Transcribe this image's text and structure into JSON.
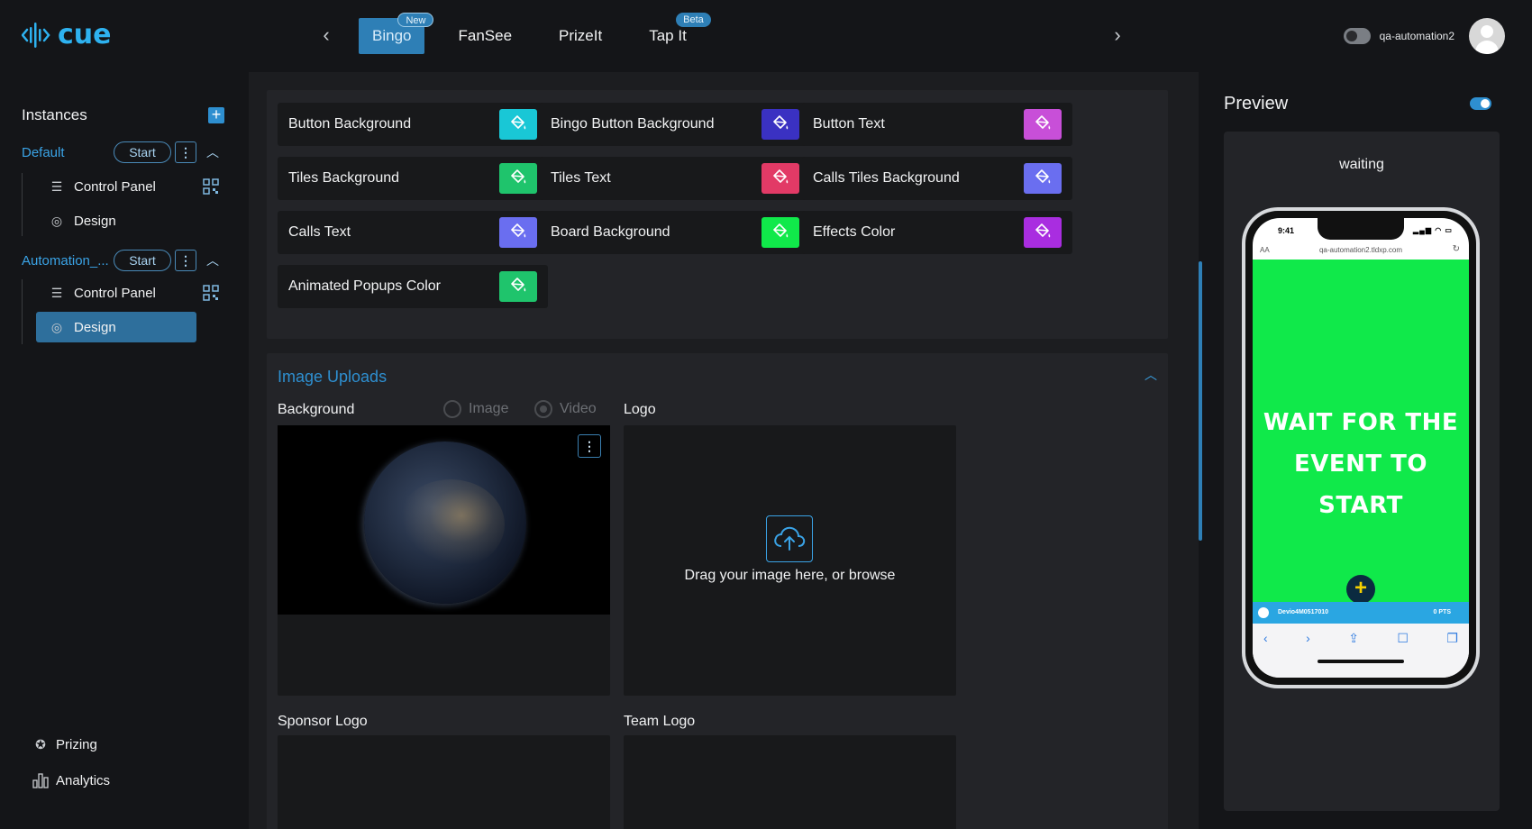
{
  "header": {
    "logo_text": "cue",
    "tabs": [
      {
        "label": "Bingo",
        "badge": "New",
        "active": true
      },
      {
        "label": "FanSee",
        "badge": "",
        "active": false
      },
      {
        "label": "PrizeIt",
        "badge": "",
        "active": false
      },
      {
        "label": "Tap It",
        "badge": "Beta",
        "active": false
      }
    ],
    "username": "qa-automation2",
    "prev_icon": "chevron-left-icon",
    "next_icon": "chevron-right-icon"
  },
  "sidebar": {
    "heading": "Instances",
    "add_icon": "plus-icon",
    "instances": [
      {
        "name": "Default",
        "start_label": "Start",
        "items": [
          {
            "label": "Control Panel",
            "icon": "sliders-icon"
          },
          {
            "label": "Design",
            "icon": "palette-icon"
          }
        ]
      },
      {
        "name": "Automation_...",
        "start_label": "Start",
        "items": [
          {
            "label": "Control Panel",
            "icon": "sliders-icon"
          },
          {
            "label": "Design",
            "icon": "palette-icon",
            "active": true
          }
        ]
      }
    ],
    "bottom": [
      {
        "label": "Prizing",
        "icon": "award-icon"
      },
      {
        "label": "Analytics",
        "icon": "bar-chart-icon"
      }
    ]
  },
  "colors": {
    "items": [
      {
        "label": "Button Background",
        "color": "#19c7d6"
      },
      {
        "label": "Bingo Button Background",
        "color": "#3a31c2"
      },
      {
        "label": "Button Text",
        "color": "#c84fd8"
      },
      {
        "label": "Tiles Background",
        "color": "#1fc46c"
      },
      {
        "label": "Tiles Text",
        "color": "#e23a66"
      },
      {
        "label": "Calls Tiles Background",
        "color": "#6a6ef0"
      },
      {
        "label": "Calls Text",
        "color": "#6a6ef0"
      },
      {
        "label": "Board Background",
        "color": "#10e94a"
      },
      {
        "label": "Effects Color",
        "color": "#a92de0"
      },
      {
        "label": "Animated Popups Color",
        "color": "#1fc46c"
      }
    ]
  },
  "uploads": {
    "title": "Image Uploads",
    "background_label": "Background",
    "radio_image": "Image",
    "radio_video": "Video",
    "radio_selected": "Video",
    "logo_label": "Logo",
    "drop_text": "Drag your image here, or browse",
    "sponsor_label": "Sponsor Logo",
    "team_label": "Team Logo"
  },
  "preview": {
    "title": "Preview",
    "status": "waiting",
    "phone": {
      "time": "9:41",
      "url": "qa-automation2.tldxp.com",
      "url_prefix": "AA",
      "message_line1": "WAIT FOR THE",
      "message_line2": "EVENT TO START",
      "player_name": "Devio4M0517010",
      "player_points": "0 PTS",
      "screen_color": "#10e94a",
      "accent_color": "#2aa6e2"
    }
  }
}
